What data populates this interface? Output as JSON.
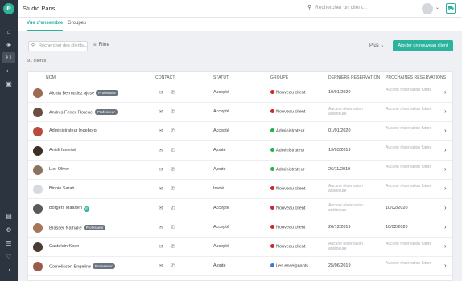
{
  "app": {
    "logo": "e",
    "title": "Studio Paris"
  },
  "search": {
    "placeholder": "Rechercher un client..."
  },
  "sidebar": {
    "icons": [
      {
        "name": "home-icon",
        "glyph": "⌂"
      },
      {
        "name": "dashboard-icon",
        "glyph": "◈"
      },
      {
        "name": "users-icon",
        "glyph": "⚇"
      },
      {
        "name": "import-icon",
        "glyph": "↵"
      },
      {
        "name": "gift-icon",
        "glyph": "▣"
      },
      {
        "name": "reports-icon",
        "glyph": "▤"
      },
      {
        "name": "settings-icon",
        "glyph": "⚙"
      },
      {
        "name": "news-icon",
        "glyph": "☰"
      },
      {
        "name": "heart-icon",
        "glyph": "♡"
      },
      {
        "name": "bell-icon",
        "glyph": "◔"
      }
    ]
  },
  "tabs": [
    {
      "label": "Vue d'ensemble",
      "active": true
    },
    {
      "label": "Groupes",
      "active": false
    }
  ],
  "toolbar": {
    "search_placeholder": "Rechercher des clients...",
    "filter_label": "Filtre",
    "more_label": "Plus",
    "add_label": "Ajouter un nouveau client"
  },
  "client_count": "91 clients",
  "table": {
    "headers": {
      "name": "NOM",
      "contact": "CONTACT",
      "status": "STATUT",
      "group": "GROUPE",
      "last": "DERNIÈRE RÉSERVATION",
      "next": "PROCHAINES RÉSERVATIONS"
    },
    "rows": [
      {
        "name": "Alcala Bermudez ajose",
        "badge": "Professeur",
        "logo": "",
        "status": "Accepté",
        "group": "Nouveau client",
        "group_color": "#d0252d",
        "last": "10/01/2020",
        "next": "Aucune réservation future",
        "avatar_color": "#9c6b52"
      },
      {
        "name": "Andres Ferrer Florenci",
        "badge": "Professeur",
        "logo": "",
        "status": "Accepté",
        "group": "Nouveau client",
        "group_color": "#d0252d",
        "last": "Aucune réservation antérieure",
        "next": "Aucune réservation future",
        "avatar_color": "#6d4c41"
      },
      {
        "name": "Administrateur Ingeborg",
        "badge": "",
        "logo": "",
        "status": "Accepté",
        "group": "Administrateur",
        "group_color": "#27b34a",
        "last": "01/01/2020",
        "next": "Aucune réservation future",
        "avatar_color": "#b84a3e"
      },
      {
        "name": "Anieli favorisé",
        "badge": "",
        "logo": "",
        "status": "Ajouté",
        "group": "Administrateur",
        "group_color": "#27b34a",
        "last": "19/03/2019",
        "next": "Aucune réservation future",
        "avatar_color": "#3d2f26"
      },
      {
        "name": "Lier Oliver",
        "badge": "",
        "logo": "",
        "status": "Ajouté",
        "group": "Administrateur",
        "group_color": "#27b34a",
        "last": "26/11/2019",
        "next": "Aucune réservation future",
        "avatar_color": "#8a7461"
      },
      {
        "name": "Binnie Sarah",
        "badge": "",
        "logo": "",
        "status": "Invité",
        "group": "Nouveau client",
        "group_color": "#d0252d",
        "last": "Aucune réservation antérieure",
        "next": "Aucune réservation future",
        "avatar_color": "#d7dadf"
      },
      {
        "name": "Borgers Maarten",
        "badge": "",
        "logo": "e",
        "status": "Accepté",
        "group": "Nouveau client",
        "group_color": "#d0252d",
        "last": "Aucune réservation antérieure",
        "next": "10/02/2020",
        "avatar_color": "#5a5a5a"
      },
      {
        "name": "Brasser Nathalie",
        "badge": "Professeur",
        "logo": "",
        "status": "Accepté",
        "group": "Nouveau client",
        "group_color": "#d0252d",
        "last": "26/12/2019",
        "next": "10/02/2020",
        "avatar_color": "#a8765a"
      },
      {
        "name": "Castelein Koen",
        "badge": "",
        "logo": "",
        "status": "Accepté",
        "group": "Nouveau client",
        "group_color": "#d0252d",
        "last": "Aucune réservation antérieure",
        "next": "Aucune réservation future",
        "avatar_color": "#4a3c34"
      },
      {
        "name": "Cornelissen Engeline",
        "badge": "Professeur",
        "logo": "",
        "status": "Ajouté",
        "group": "Les enseignants",
        "group_color": "#2f7fd6",
        "last": "25/06/2019",
        "next": "Aucune réservation future",
        "avatar_color": "#9b5b4a"
      }
    ]
  },
  "icons": {
    "mail": "✉",
    "phone": "✆",
    "chevron": "›",
    "search": "⚲",
    "filter": "≡",
    "cart": "⛟",
    "caret": "⌄"
  },
  "colors": {
    "accent": "#2bb39b",
    "sidebar": "#2c3440"
  }
}
